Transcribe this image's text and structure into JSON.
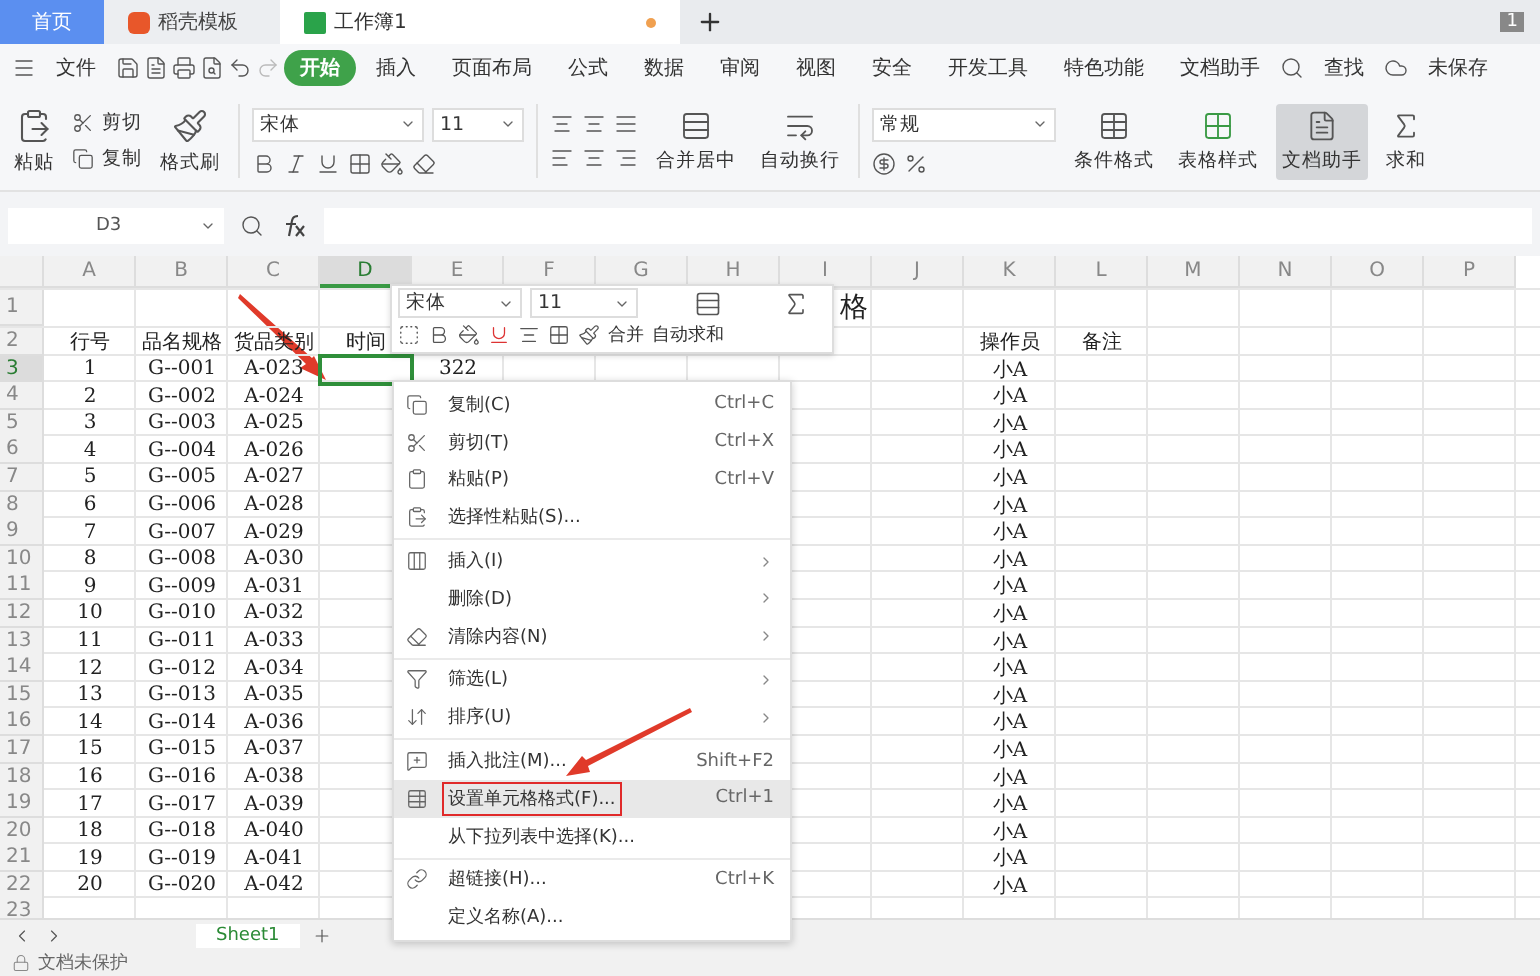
{
  "tabs": [
    {
      "label": "首页",
      "kind": "home",
      "selected": false
    },
    {
      "label": "稻壳模板",
      "kind": "docer",
      "selected": false
    },
    {
      "label": "工作簿1",
      "kind": "sheet",
      "selected": true
    }
  ],
  "page_badge": "1",
  "menu": {
    "file": "文件",
    "items": [
      {
        "label": "开始",
        "selected": true
      },
      {
        "label": "插入",
        "selected": false
      },
      {
        "label": "页面布局",
        "selected": false
      },
      {
        "label": "公式",
        "selected": false
      },
      {
        "label": "数据",
        "selected": false
      },
      {
        "label": "审阅",
        "selected": false
      },
      {
        "label": "视图",
        "selected": false
      },
      {
        "label": "安全",
        "selected": false
      },
      {
        "label": "开发工具",
        "selected": false
      },
      {
        "label": "特色功能",
        "selected": false
      },
      {
        "label": "文档助手",
        "selected": false
      }
    ],
    "search": "查找",
    "save_status": "未保存"
  },
  "ribbon": {
    "paste": "粘贴",
    "cut": "剪切",
    "copy": "复制",
    "format_painter": "格式刷",
    "font": "宋体",
    "size": "11",
    "merge": "合并居中",
    "wrap": "自动换行",
    "number_format": "常规",
    "conditional": "条件格式",
    "table_style": "表格样式",
    "doc_helper": {
      "label": "文档助手",
      "selected": true
    },
    "sum": "求和"
  },
  "formula_bar": {
    "cell_ref": "D3"
  },
  "sheet": {
    "columns": [
      {
        "label": "A",
        "selected": false
      },
      {
        "label": "B",
        "selected": false
      },
      {
        "label": "C",
        "selected": false
      },
      {
        "label": "D",
        "selected": true
      },
      {
        "label": "E",
        "selected": false
      },
      {
        "label": "F",
        "selected": false
      },
      {
        "label": "G",
        "selected": false
      },
      {
        "label": "H",
        "selected": false
      },
      {
        "label": "I",
        "selected": false
      },
      {
        "label": "J",
        "selected": false
      },
      {
        "label": "K",
        "selected": false
      },
      {
        "label": "L",
        "selected": false
      },
      {
        "label": "M",
        "selected": false
      },
      {
        "label": "N",
        "selected": false
      },
      {
        "label": "O",
        "selected": false
      },
      {
        "label": "P",
        "selected": false
      }
    ],
    "rows": [
      {
        "num": "1",
        "selected": false,
        "cells": {
          "I": "格"
        }
      },
      {
        "num": "2",
        "selected": false,
        "cells": {
          "A": "行号",
          "B": "品名规格",
          "C": "货品类别",
          "D": "时间",
          "K": "操作员",
          "L": "备注"
        }
      },
      {
        "num": "3",
        "selected": true,
        "cells": {
          "A": "1",
          "B": "G--001",
          "C": "A-023",
          "E": "322",
          "K": "小A"
        }
      },
      {
        "num": "4",
        "selected": false,
        "cells": {
          "A": "2",
          "B": "G--002",
          "C": "A-024",
          "K": "小A"
        }
      },
      {
        "num": "5",
        "selected": false,
        "cells": {
          "A": "3",
          "B": "G--003",
          "C": "A-025",
          "K": "小A"
        }
      },
      {
        "num": "6",
        "selected": false,
        "cells": {
          "A": "4",
          "B": "G--004",
          "C": "A-026",
          "K": "小A"
        }
      },
      {
        "num": "7",
        "selected": false,
        "cells": {
          "A": "5",
          "B": "G--005",
          "C": "A-027",
          "K": "小A"
        }
      },
      {
        "num": "8",
        "selected": false,
        "cells": {
          "A": "6",
          "B": "G--006",
          "C": "A-028",
          "K": "小A"
        }
      },
      {
        "num": "9",
        "selected": false,
        "cells": {
          "A": "7",
          "B": "G--007",
          "C": "A-029",
          "K": "小A"
        }
      },
      {
        "num": "10",
        "selected": false,
        "cells": {
          "A": "8",
          "B": "G--008",
          "C": "A-030",
          "K": "小A"
        }
      },
      {
        "num": "11",
        "selected": false,
        "cells": {
          "A": "9",
          "B": "G--009",
          "C": "A-031",
          "K": "小A"
        }
      },
      {
        "num": "12",
        "selected": false,
        "cells": {
          "A": "10",
          "B": "G--010",
          "C": "A-032",
          "K": "小A"
        }
      },
      {
        "num": "13",
        "selected": false,
        "cells": {
          "A": "11",
          "B": "G--011",
          "C": "A-033",
          "K": "小A"
        }
      },
      {
        "num": "14",
        "selected": false,
        "cells": {
          "A": "12",
          "B": "G--012",
          "C": "A-034",
          "K": "小A"
        }
      },
      {
        "num": "15",
        "selected": false,
        "cells": {
          "A": "13",
          "B": "G--013",
          "C": "A-035",
          "K": "小A"
        }
      },
      {
        "num": "16",
        "selected": false,
        "cells": {
          "A": "14",
          "B": "G--014",
          "C": "A-036",
          "K": "小A"
        }
      },
      {
        "num": "17",
        "selected": false,
        "cells": {
          "A": "15",
          "B": "G--015",
          "C": "A-037",
          "K": "小A"
        }
      },
      {
        "num": "18",
        "selected": false,
        "cells": {
          "A": "16",
          "B": "G--016",
          "C": "A-038",
          "K": "小A"
        }
      },
      {
        "num": "19",
        "selected": false,
        "cells": {
          "A": "17",
          "B": "G--017",
          "C": "A-039",
          "K": "小A"
        }
      },
      {
        "num": "20",
        "selected": false,
        "cells": {
          "A": "18",
          "B": "G--018",
          "C": "A-040",
          "K": "小A"
        }
      },
      {
        "num": "21",
        "selected": false,
        "cells": {
          "A": "19",
          "B": "G--019",
          "C": "A-041",
          "K": "小A"
        }
      },
      {
        "num": "22",
        "selected": false,
        "cells": {
          "A": "20",
          "B": "G--020",
          "C": "A-042",
          "K": "小A"
        }
      },
      {
        "num": "23",
        "selected": false,
        "cells": {}
      }
    ]
  },
  "mini_toolbar": {
    "font": "宋体",
    "size": "11",
    "merge": "合并",
    "autosum": "自动求和"
  },
  "context_menu": {
    "items": [
      {
        "kind": "item",
        "label": "复制(C)",
        "shortcut": "Ctrl+C",
        "submenu": false,
        "highlighted": false,
        "annotated": false
      },
      {
        "kind": "item",
        "label": "剪切(T)",
        "shortcut": "Ctrl+X",
        "submenu": false,
        "highlighted": false,
        "annotated": false
      },
      {
        "kind": "item",
        "label": "粘贴(P)",
        "shortcut": "Ctrl+V",
        "submenu": false,
        "highlighted": false,
        "annotated": false
      },
      {
        "kind": "item",
        "label": "选择性粘贴(S)...",
        "submenu": false,
        "highlighted": false,
        "annotated": false
      },
      {
        "kind": "separator"
      },
      {
        "kind": "item",
        "label": "插入(I)",
        "submenu": true,
        "highlighted": false,
        "annotated": false
      },
      {
        "kind": "item",
        "label": "删除(D)",
        "submenu": true,
        "highlighted": false,
        "annotated": false
      },
      {
        "kind": "item",
        "label": "清除内容(N)",
        "submenu": true,
        "highlighted": false,
        "annotated": false
      },
      {
        "kind": "separator"
      },
      {
        "kind": "item",
        "label": "筛选(L)",
        "submenu": true,
        "highlighted": false,
        "annotated": false
      },
      {
        "kind": "item",
        "label": "排序(U)",
        "submenu": true,
        "highlighted": false,
        "annotated": false
      },
      {
        "kind": "separator"
      },
      {
        "kind": "item",
        "label": "插入批注(M)...",
        "shortcut": "Shift+F2",
        "submenu": false,
        "highlighted": false,
        "annotated": false
      },
      {
        "kind": "item",
        "label": "设置单元格格式(F)...",
        "shortcut": "Ctrl+1",
        "submenu": false,
        "highlighted": true,
        "annotated": true
      },
      {
        "kind": "item",
        "label": "从下拉列表中选择(K)...",
        "submenu": false,
        "highlighted": false,
        "annotated": false
      },
      {
        "kind": "separator"
      },
      {
        "kind": "item",
        "label": "超链接(H)...",
        "shortcut": "Ctrl+K",
        "submenu": false,
        "highlighted": false,
        "annotated": false
      },
      {
        "kind": "item",
        "label": "定义名称(A)...",
        "submenu": false,
        "highlighted": false,
        "annotated": false
      }
    ]
  },
  "sheet_tabs": [
    {
      "label": "Sheet1",
      "selected": true
    }
  ],
  "status": "文档未保护"
}
